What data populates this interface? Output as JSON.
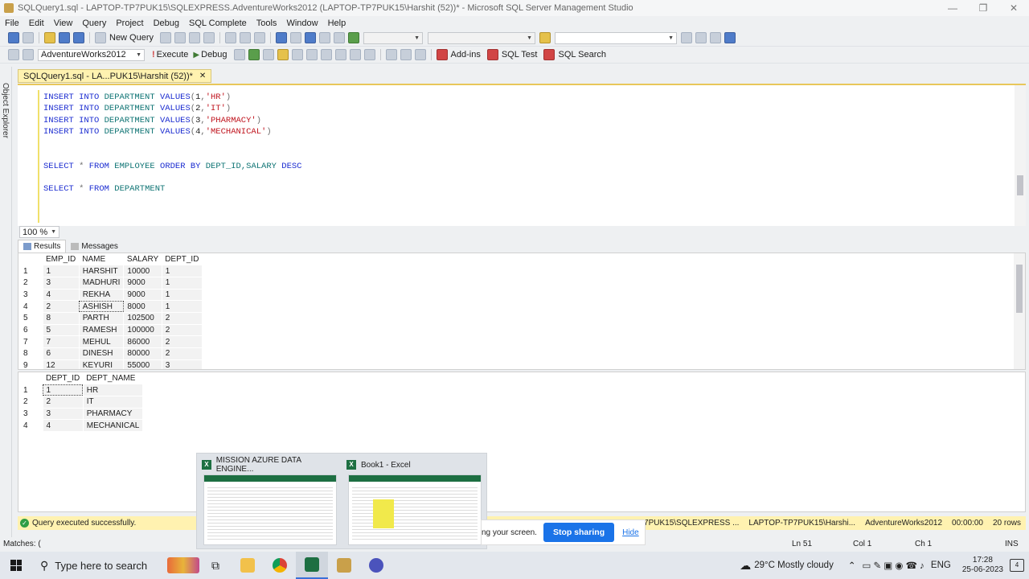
{
  "window": {
    "title": "SQLQuery1.sql - LAPTOP-TP7PUK15\\SQLEXPRESS.AdventureWorks2012 (LAPTOP-TP7PUK15\\Harshit (52))* - Microsoft SQL Server Management Studio",
    "minimize": "—",
    "restore": "❐",
    "close": "✕"
  },
  "menu": [
    "File",
    "Edit",
    "View",
    "Query",
    "Project",
    "Debug",
    "SQL Complete",
    "Tools",
    "Window",
    "Help"
  ],
  "toolbar": {
    "new_query": "New Query",
    "database": "AdventureWorks2012",
    "execute": "Execute",
    "debug": "Debug",
    "addins": "Add-ins",
    "sql_test": "SQL Test",
    "sql_search": "SQL Search"
  },
  "sidebar": {
    "object_explorer": "Object Explorer"
  },
  "doc_tab": {
    "label": "SQLQuery1.sql - LA...PUK15\\Harshit (52))*",
    "close": "✕"
  },
  "code": {
    "insert_kw": "INSERT INTO",
    "table_dept": "DEPARTMENT",
    "values_kw": "VALUES",
    "inserts": [
      {
        "id": "1",
        "name": "'HR'"
      },
      {
        "id": "2",
        "name": "'IT'"
      },
      {
        "id": "3",
        "name": "'PHARMACY'"
      },
      {
        "id": "4",
        "name": "'MECHANICAL'"
      }
    ],
    "select_kw": "SELECT",
    "star": "*",
    "from_kw": "FROM",
    "table_emp": "EMPLOYEE",
    "order_kw": "ORDER BY",
    "order_cols": "DEPT_ID,SALARY",
    "desc_kw": "DESC"
  },
  "zoom": "100 %",
  "result_tabs": {
    "results": "Results",
    "messages": "Messages"
  },
  "grid1": {
    "columns": [
      "EMP_ID",
      "NAME",
      "SALARY",
      "DEPT_ID"
    ],
    "rows": [
      [
        "1",
        "1",
        "HARSHIT",
        "10000",
        "1"
      ],
      [
        "2",
        "3",
        "MADHURI",
        "9000",
        "1"
      ],
      [
        "3",
        "4",
        "REKHA",
        "9000",
        "1"
      ],
      [
        "4",
        "2",
        "ASHISH",
        "8000",
        "1"
      ],
      [
        "5",
        "8",
        "PARTH",
        "102500",
        "2"
      ],
      [
        "6",
        "5",
        "RAMESH",
        "100000",
        "2"
      ],
      [
        "7",
        "7",
        "MEHUL",
        "86000",
        "2"
      ],
      [
        "8",
        "6",
        "DINESH",
        "80000",
        "2"
      ],
      [
        "9",
        "12",
        "KEYURI",
        "55000",
        "3"
      ]
    ]
  },
  "grid2": {
    "columns": [
      "DEPT_ID",
      "DEPT_NAME"
    ],
    "rows": [
      [
        "1",
        "1",
        "HR"
      ],
      [
        "2",
        "2",
        "IT"
      ],
      [
        "3",
        "3",
        "PHARMACY"
      ],
      [
        "4",
        "4",
        "MECHANICAL"
      ]
    ]
  },
  "status": {
    "message": "Query executed successfully.",
    "server": "LAPTOP-TP7PUK15\\SQLEXPRESS ...",
    "user": "LAPTOP-TP7PUK15\\Harshi...",
    "database": "AdventureWorks2012",
    "elapsed": "00:00:00",
    "rows": "20 rows"
  },
  "bottom": {
    "matches": "Matches: (",
    "ln": "Ln 51",
    "col": "Col 1",
    "ch": "Ch 1",
    "mode": "INS"
  },
  "thumbnails": [
    {
      "title": "MISSION AZURE DATA ENGINE..."
    },
    {
      "title": "Book1 - Excel"
    }
  ],
  "share": {
    "text": "ng your screen.",
    "stop": "Stop sharing",
    "hide": "Hide"
  },
  "taskbar": {
    "search_placeholder": "Type here to search",
    "weather": "29°C  Mostly cloudy",
    "lang": "ENG",
    "time": "17:28",
    "date": "25-06-2023",
    "notifications": "4"
  }
}
